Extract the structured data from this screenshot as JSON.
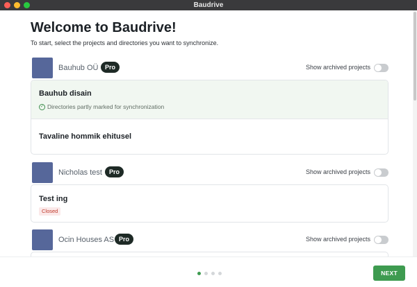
{
  "window": {
    "title": "Baudrive"
  },
  "page": {
    "heading": "Welcome to Baudrive!",
    "subtitle": "To start, select the projects and directories you want to synchronize."
  },
  "organizations": [
    {
      "name": "Bauhub OÜ",
      "badge": "Pro",
      "archived_label": "Show archived projects",
      "show_archived": false,
      "projects": [
        {
          "name": "Bauhub disain",
          "status": "Directories partly marked for synchronization",
          "highlighted": true
        },
        {
          "name": "Tavaline hommik ehitusel"
        }
      ]
    },
    {
      "name": "Nicholas test",
      "badge": "Pro",
      "archived_label": "Show archived projects",
      "show_archived": false,
      "projects": [
        {
          "name": "Test ing",
          "tag": "Closed"
        }
      ]
    },
    {
      "name": "Ocin Houses AS",
      "badge": "Pro",
      "archived_label": "Show archived projects",
      "show_archived": false,
      "projects": []
    }
  ],
  "footer": {
    "pages_total": 4,
    "current_page": 1,
    "next_label": "NEXT"
  },
  "colors": {
    "accent": "#3e9b50",
    "badge_bg": "#1e2a26",
    "avatar": "#56679a",
    "highlight_bg": "#f1f7f1",
    "closed_tag": "#c0392b"
  }
}
